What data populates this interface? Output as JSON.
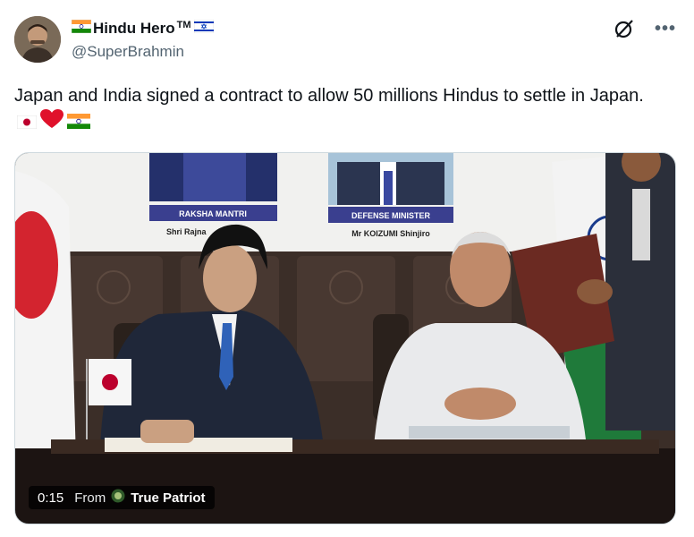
{
  "author": {
    "display_name": "Hindu Hero",
    "trademark": "TM",
    "handle": "@SuperBrahmin"
  },
  "icons": {
    "grok": "grok-slash-circle-icon",
    "more": "more-dots-icon",
    "more_glyph": "•••"
  },
  "tweet": {
    "text": "Japan and India signed a contract to allow 50 millions Hindus to settle in Japan.",
    "emojis": [
      "japan-flag",
      "red-heart",
      "india-flag"
    ]
  },
  "media": {
    "placard_left_title": "RAKSHA MANTRI",
    "placard_left_name": "Shri Rajna",
    "placard_right_title": "DEFENSE MINISTER",
    "placard_right_name": "Mr KOIZUMI Shinjiro"
  },
  "video": {
    "duration": "0:15",
    "from_label": "From",
    "source": "True Patriot"
  },
  "colors": {
    "text": "#0f1419",
    "secondary": "#536471",
    "placard_bar": "#3a3f8f",
    "border": "#cfd9de"
  }
}
